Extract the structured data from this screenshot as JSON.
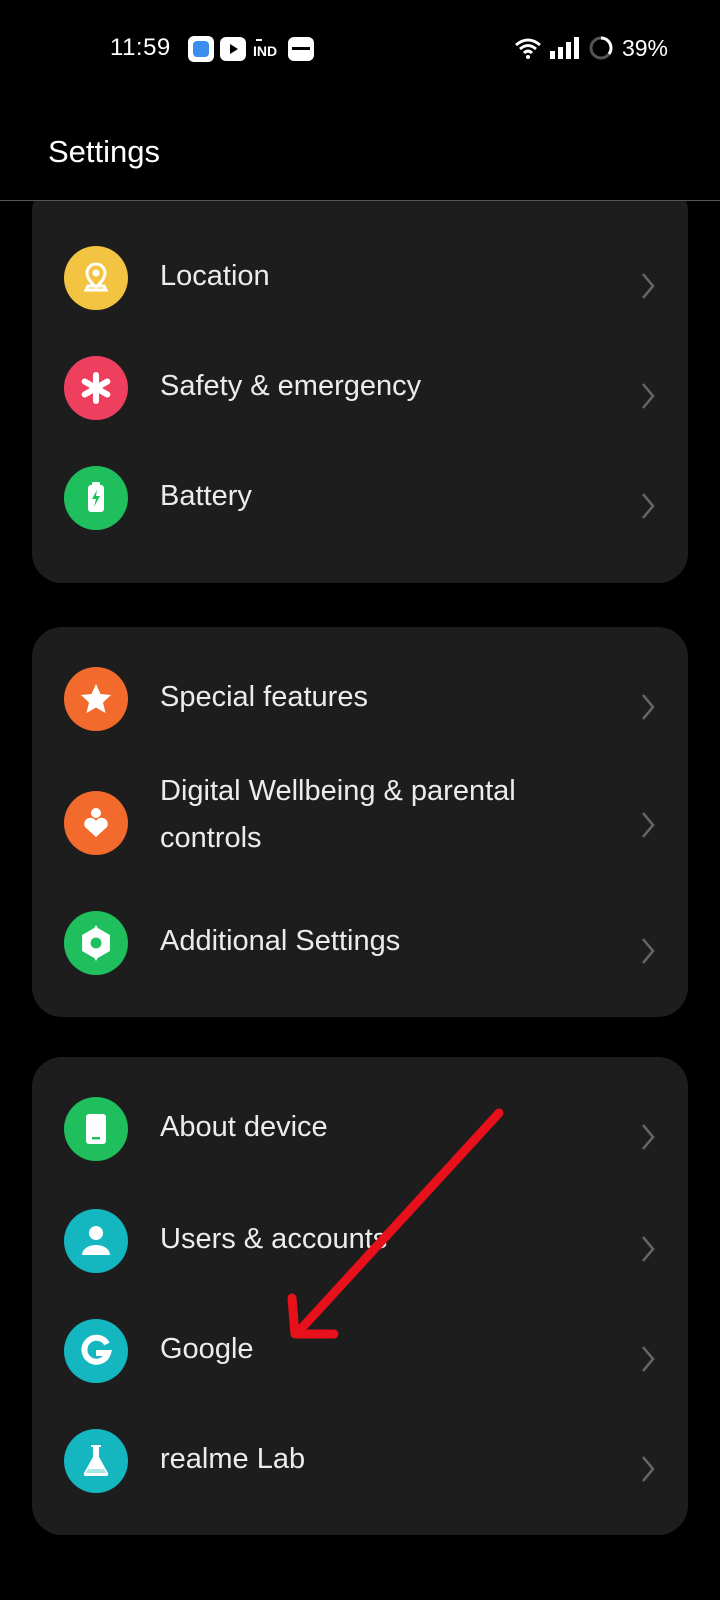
{
  "status_bar": {
    "time": "11:59",
    "battery": "39%",
    "notification_icons": [
      "app-icon",
      "youtube-icon",
      "ind-icon",
      "zomato-icon"
    ]
  },
  "header": {
    "title": "Settings"
  },
  "cards": [
    {
      "items": [
        {
          "label": "Location",
          "icon": "location-icon",
          "color": "#f2c441"
        },
        {
          "label": "Safety & emergency",
          "icon": "asterisk-icon",
          "color": "#ef3f5f"
        },
        {
          "label": "Battery",
          "icon": "battery-icon",
          "color": "#1fbf5e"
        }
      ]
    },
    {
      "items": [
        {
          "label": "Special features",
          "icon": "star-icon",
          "color": "#f26a2c"
        },
        {
          "label_line1": "Digital Wellbeing & parental",
          "label_line2": "controls",
          "icon": "heart-person-icon",
          "color": "#f26a2c"
        },
        {
          "label": "Additional Settings",
          "icon": "gear-icon",
          "color": "#1fbf5e"
        }
      ]
    },
    {
      "items": [
        {
          "label": "About device",
          "icon": "phone-icon",
          "color": "#1fbf5e"
        },
        {
          "label": "Users & accounts",
          "icon": "user-icon",
          "color": "#14b7c0"
        },
        {
          "label": "Google",
          "icon": "google-icon",
          "color": "#14b7c0"
        },
        {
          "label": "realme Lab",
          "icon": "flask-icon",
          "color": "#14b7c0"
        }
      ]
    }
  ],
  "annotation": {
    "color": "#e8101a"
  }
}
